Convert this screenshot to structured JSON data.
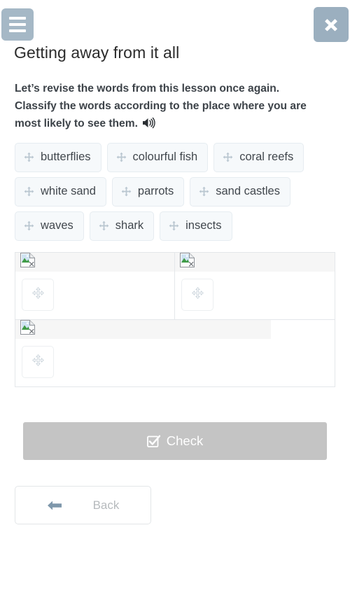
{
  "header": {
    "menu_icon": "hamburger-menu-icon",
    "menu_color": "#a5b8c6",
    "close_icon": "close-x-icon",
    "close_color": "#9bafbf"
  },
  "page": {
    "title": "Getting away from it all"
  },
  "instruction": {
    "text": "Let’s revise the words from this lesson once again. Classify the words according to the place where you are most likely to see them.",
    "audio_icon": "speaker-volume-icon"
  },
  "word_bank": {
    "drag_icon": "move-arrows-icon",
    "chips": [
      {
        "label": "butterflies"
      },
      {
        "label": "colourful fish"
      },
      {
        "label": "coral reefs"
      },
      {
        "label": "white sand"
      },
      {
        "label": "parrots"
      },
      {
        "label": "sand castles"
      },
      {
        "label": "waves"
      },
      {
        "label": "shark"
      },
      {
        "label": "insects"
      }
    ]
  },
  "dropzones": {
    "placeholder_icon": "broken-image-icon",
    "slot_icon": "move-arrows-icon",
    "zones": [
      {
        "name": "category-1",
        "image_alt": "",
        "layout": "half"
      },
      {
        "name": "category-2",
        "image_alt": "",
        "layout": "half"
      },
      {
        "name": "category-3",
        "image_alt": "",
        "layout": "full"
      }
    ]
  },
  "actions": {
    "check_label": "Check",
    "check_icon": "checkbox-checked-icon",
    "check_disabled": true,
    "check_color": "#c4c4c4",
    "back_label": "Back",
    "back_icon": "arrow-left-icon",
    "back_arrow_color": "#7e97ab"
  }
}
